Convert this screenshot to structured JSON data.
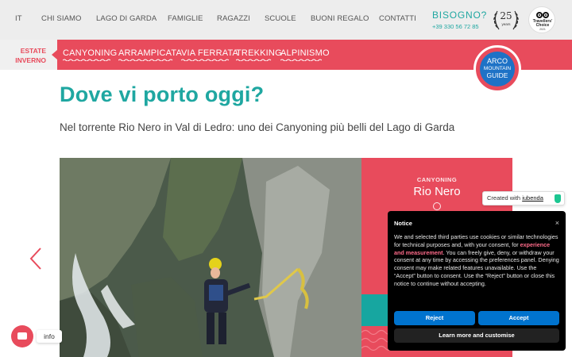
{
  "nav": {
    "items": [
      "IT",
      "CHI SIAMO",
      "LAGO DI GARDA",
      "FAMIGLIE",
      "RAGAZZI",
      "SCUOLE",
      "BUONI REGALO",
      "CONTATTI"
    ]
  },
  "help": {
    "title": "BISOGNO?",
    "phone": "+39 330 56 72 85"
  },
  "badges": {
    "years_number": "25",
    "years_label": "years",
    "ta_line1": "Travellers'",
    "ta_line2": "Choice",
    "ta_year": "2021"
  },
  "season": {
    "summer": "ESTATE",
    "winter": "INVERNO"
  },
  "categories": [
    "CANYONING",
    "ARRAMPICATA",
    "VIA FERRATA",
    "TREKKING",
    "ALPINISMO"
  ],
  "logo": {
    "line1": "ARCO",
    "line2": "MOUNTAIN",
    "line3": "GUIDE"
  },
  "hero": {
    "title": "Dove vi porto oggi?",
    "subtitle": "Nel torrente Rio Nero in Val di Ledro: uno dei Canyoning più belli del Lago di Garda"
  },
  "card": {
    "category": "CANYONING",
    "name": "Rio Nero"
  },
  "iubenda": {
    "created_with": "Created with",
    "brand": "iubenda"
  },
  "notice": {
    "title": "Notice",
    "close": "×",
    "text_before": "We and selected third parties use cookies or similar technologies for technical purposes and, with your consent, for ",
    "text_highlight": "experience and measurement",
    "text_after": ". You can freely give, deny, or withdraw your consent at any time by accessing the preferences panel. Denying consent may make related features unavailable. Use the “Accept” button to consent. Use the “Reject” button or close this notice to continue without accepting.",
    "reject": "Reject",
    "accept": "Accept",
    "learn_more": "Learn more and customise"
  },
  "chat": {
    "label": "info"
  },
  "colors": {
    "coral": "#e84b5c",
    "teal": "#1fa7a1",
    "blue": "#0073ce",
    "logo_blue": "#1e72c6"
  }
}
